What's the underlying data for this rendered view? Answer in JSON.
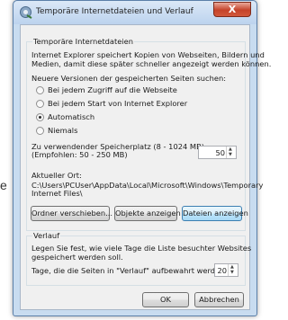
{
  "background": {
    "char": "e"
  },
  "window": {
    "title": "Temporäre Internetdateien und Verlauf",
    "close_label": "X"
  },
  "temp": {
    "legend": "Temporäre Internetdateien",
    "description": [
      "Internet Explorer speichert Kopien von Webseiten, Bildern und",
      "Medien, damit diese später schneller angezeigt werden können."
    ],
    "check_prompt": "Neuere Versionen der gespeicherten Seiten suchen:",
    "radios": [
      {
        "label": "Bei jedem Zugriff auf die Webseite",
        "selected": false
      },
      {
        "label": "Bei jedem Start von Internet Explorer",
        "selected": false
      },
      {
        "label": "Automatisch",
        "selected": true
      },
      {
        "label": "Niemals",
        "selected": false
      }
    ],
    "disk_label": [
      "Zu verwendender Speicherplatz (8 - 1024 MB)",
      "(Empfohlen: 50 - 250 MB)"
    ],
    "disk_value": "50",
    "location_label": "Aktueller Ort:",
    "location_path": [
      "C:\\Users\\PCUser\\AppData\\Local\\Microsoft\\Windows\\Temporary",
      "Internet Files\\"
    ],
    "buttons": {
      "move": "Ordner verschieben...",
      "objects": "Objekte anzeigen",
      "files": "Dateien anzeigen"
    }
  },
  "history": {
    "legend": "Verlauf",
    "description": [
      "Legen Sie fest, wie viele Tage die Liste besuchter Websites",
      "gespeichert werden soll."
    ],
    "days_label": "Tage, die die Seiten in \"Verlauf\" aufbewahrt werden:",
    "days_value": "20"
  },
  "footer": {
    "ok": "OK",
    "cancel": "Abbrechen"
  }
}
